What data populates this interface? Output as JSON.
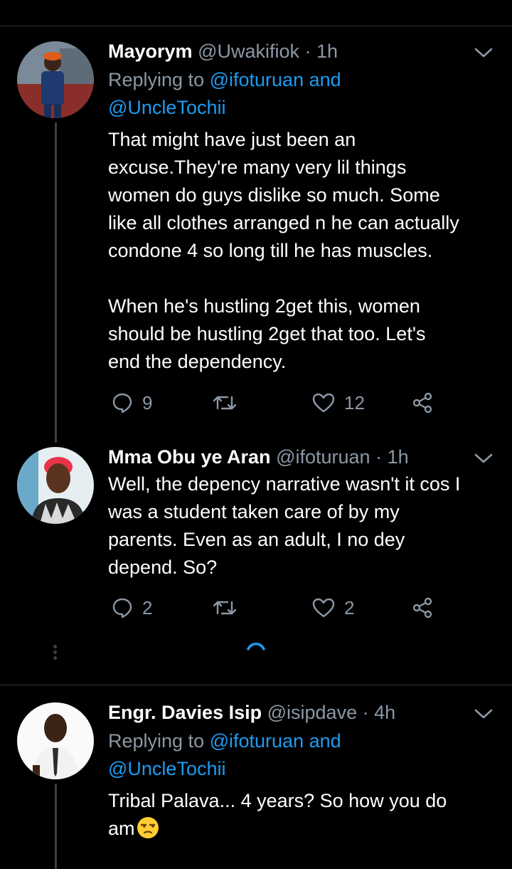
{
  "tweets": [
    {
      "name": "Mayorym",
      "handle": "@Uwakifiok",
      "separator": "·",
      "time": "1h",
      "replying_prefix": "Replying to",
      "replying_line1": "@ifoturuan and",
      "replying_line2": "@UncleTochii",
      "text": "That might have just been an\nexcuse.They're many very lil things\nwomen do guys dislike so much. Some\nlike all clothes arranged n he can actually\ncondone 4 so long till he has muscles.\n\nWhen he's hustling 2get this, women\nshould be hustling 2get that too. Let's\nend the dependency.",
      "replies": "9",
      "retweets": "",
      "likes": "12"
    },
    {
      "name": "Mma Obu ye Aran",
      "handle": "@ifoturuan",
      "separator": "·",
      "time": "1h",
      "text": "Well, the depency narrative wasn't it cos I\nwas a student taken care of by my\nparents. Even as an adult, I no dey\ndepend. So?",
      "replies": "2",
      "retweets": "",
      "likes": "2"
    },
    {
      "name": "Engr. Davies Isip",
      "handle": "@isipdave",
      "separator": "·",
      "time": "4h",
      "replying_prefix": "Replying to",
      "replying_line1": "@ifoturuan and",
      "replying_line2": "@UncleTochii",
      "text": "Tribal Palava... 4 years? So how you do\nam",
      "emoji": "unamused-face-emoji"
    }
  ],
  "icons": {
    "reply": "reply-icon",
    "retweet": "retweet-icon",
    "like": "heart-icon",
    "share": "share-icon",
    "more": "chevron-down-icon",
    "loading": "loading-spinner"
  },
  "colors": {
    "background": "#000000",
    "secondary_text": "#8b98a5",
    "accent": "#1d9bf0",
    "divider": "#2f3336"
  }
}
